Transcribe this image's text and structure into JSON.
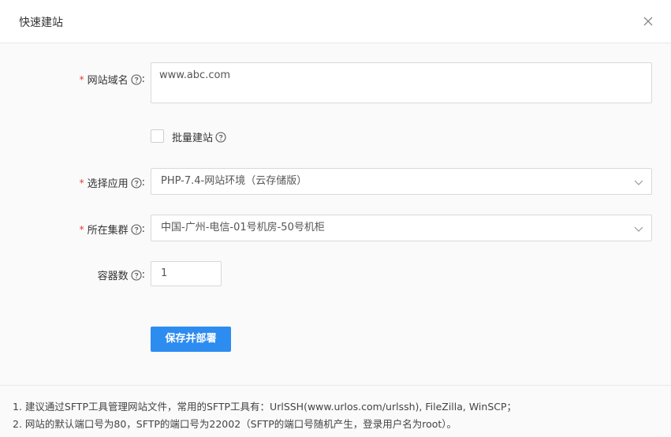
{
  "dialog": {
    "title": "快速建站",
    "close_icon": "close-icon"
  },
  "form": {
    "domain": {
      "label": "网站域名",
      "colon": ":",
      "value": "www.abc.com",
      "required": true
    },
    "batch": {
      "label": "批量建站",
      "checked": false
    },
    "app": {
      "label": "选择应用",
      "colon": ":",
      "value": "PHP-7.4-网站环境（云存储版）",
      "required": true
    },
    "cluster": {
      "label": "所在集群",
      "colon": ":",
      "value": "中国-广州-电信-01号机房-50号机柜",
      "required": true
    },
    "containers": {
      "label": "容器数",
      "colon": ":",
      "value": "1"
    },
    "submit_label": "保存并部署"
  },
  "notes": [
    "1. 建议通过SFTP工具管理网站文件，常用的SFTP工具有：UrlSSH(www.urlos.com/urlssh), FileZilla, WinSCP；",
    "2. 网站的默认端口号为80，SFTP的端口号为22002（SFTP的端口号随机产生，登录用户名为root）。"
  ],
  "colors": {
    "primary": "#2d8cf0",
    "required": "#e53935"
  }
}
